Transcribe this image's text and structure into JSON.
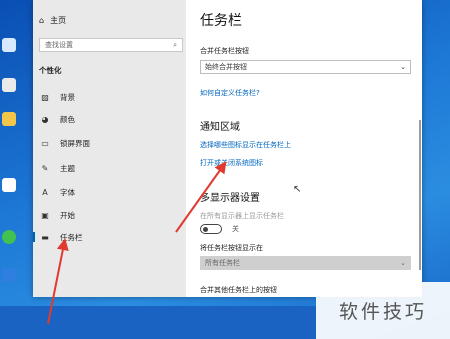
{
  "sidebar": {
    "home_label": "主页",
    "search_placeholder": "查找设置",
    "section_title": "个性化",
    "items": [
      {
        "label": "背景",
        "icon": "image-icon"
      },
      {
        "label": "颜色",
        "icon": "palette-icon"
      },
      {
        "label": "锁屏界面",
        "icon": "lock-screen-icon"
      },
      {
        "label": "主题",
        "icon": "brush-icon"
      },
      {
        "label": "字体",
        "icon": "font-icon"
      },
      {
        "label": "开始",
        "icon": "start-icon"
      },
      {
        "label": "任务栏",
        "icon": "taskbar-icon"
      }
    ]
  },
  "content": {
    "title": "任务栏",
    "combine_label": "合并任务栏按钮",
    "combine_value": "始终合并按钮",
    "customize_link": "如何自定义任务栏?",
    "notification_heading": "通知区域",
    "select_icons_link": "选择哪些图标显示在任务栏上",
    "toggle_system_icons_link": "打开或关闭系统图标",
    "multi_display_heading": "多显示器设置",
    "show_all_displays_label": "在所有显示器上显示任务栏",
    "toggle_state": "关",
    "show_buttons_label": "将任务栏按钮显示在",
    "show_buttons_value": "所有任务栏",
    "combine_other_label": "合并其他任务栏上的按钮"
  },
  "watermark": "软件技巧",
  "colors": {
    "accent": "#0063b1",
    "link": "#0066c0",
    "arrow": "#e03a2f",
    "sidebar_bg": "#e9e9e9"
  }
}
